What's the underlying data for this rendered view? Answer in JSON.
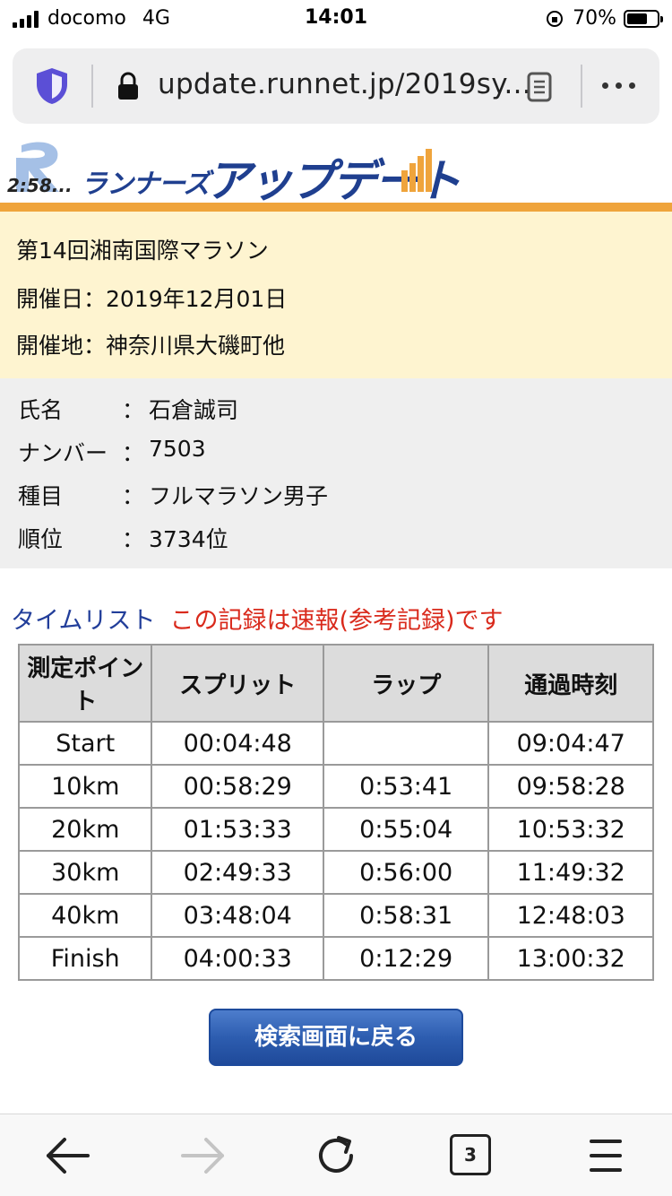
{
  "status_bar": {
    "carrier": "docomo",
    "network": "4G",
    "time": "14:01",
    "battery": "70%"
  },
  "browser": {
    "url": "update.runnet.jp/2019sy...",
    "tab_count": "3"
  },
  "logo": {
    "mark_text": "2:58...",
    "small_text": "ランナーズ",
    "big_text": "アップデート"
  },
  "event": {
    "name": "第14回湘南国際マラソン",
    "date_label": "開催日：",
    "date": "2019年12月01日",
    "place_label": "開催地：",
    "place": "神奈川県大磯町他"
  },
  "runner": {
    "rows": [
      {
        "label": "氏名",
        "colon": "：",
        "value": "石倉誠司"
      },
      {
        "label": "ナンバー",
        "colon": "：",
        "value": "7503"
      },
      {
        "label": "種目",
        "colon": "：",
        "value": "フルマラソン男子"
      },
      {
        "label": "順位",
        "colon": "：",
        "value": "3734位"
      }
    ]
  },
  "time_list": {
    "title": "タイムリスト",
    "note": "この記録は速報(参考記録)です",
    "headers": [
      "測定ポイント",
      "スプリット",
      "ラップ",
      "通過時刻"
    ],
    "rows": [
      [
        "Start",
        "00:04:48",
        "",
        "09:04:47"
      ],
      [
        "10km",
        "00:58:29",
        "0:53:41",
        "09:58:28"
      ],
      [
        "20km",
        "01:53:33",
        "0:55:04",
        "10:53:32"
      ],
      [
        "30km",
        "02:49:33",
        "0:56:00",
        "11:49:32"
      ],
      [
        "40km",
        "03:48:04",
        "0:58:31",
        "12:48:03"
      ],
      [
        "Finish",
        "04:00:33",
        "0:12:29",
        "13:00:32"
      ]
    ]
  },
  "back_button_label": "検索画面に戻る",
  "colors": {
    "accent_orange": "#efa43c",
    "event_bg": "#fef4d0",
    "title_blue": "#223e9a",
    "note_red": "#d92a1c",
    "button_blue": "#2d5db0"
  }
}
